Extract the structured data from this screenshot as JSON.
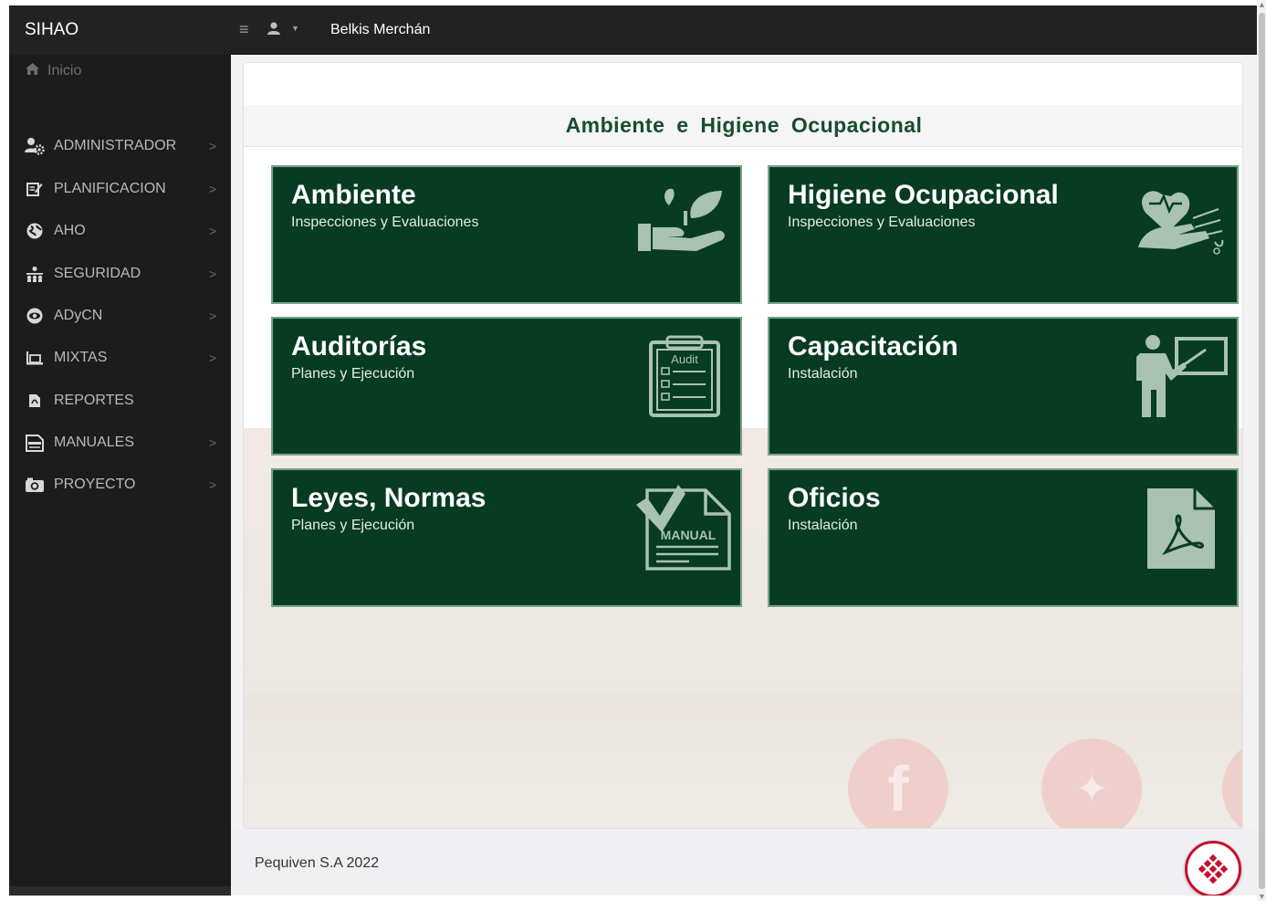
{
  "app": {
    "brand": "SIHAO"
  },
  "sidebar": {
    "home": {
      "label": "Inicio",
      "icon": "home-icon"
    },
    "items": [
      {
        "label": "ADMINISTRADOR",
        "icon": "users-gear-icon"
      },
      {
        "label": "PLANIFICACION",
        "icon": "edit-document-icon"
      },
      {
        "label": "AHO",
        "icon": "globe-icon"
      },
      {
        "label": "SEGURIDAD",
        "icon": "network-icon"
      },
      {
        "label": "ADyCN",
        "icon": "eye-icon"
      },
      {
        "label": "MIXTAS",
        "icon": "laptop-icon"
      },
      {
        "label": "REPORTES",
        "icon": "pdf-file-icon"
      },
      {
        "label": "MANUALES",
        "icon": "manual-icon"
      },
      {
        "label": "PROYECTO",
        "icon": "camera-icon"
      }
    ]
  },
  "topbar": {
    "username": "Belkis Merchán"
  },
  "main": {
    "heading": "Ambiente e Higiene Ocupacional",
    "tiles": [
      {
        "title": "Ambiente",
        "subtitle": "Inspecciones y Evaluaciones",
        "icon": "plant-hand-icon"
      },
      {
        "title": "Higiene Ocupacional",
        "subtitle": "Inspecciones y Evaluaciones",
        "icon": "heart-hand-icon"
      },
      {
        "title": "Auditorías",
        "subtitle": "Planes y Ejecución",
        "icon": "audit-clipboard-icon",
        "icon_text": "Audit"
      },
      {
        "title": "Capacitación",
        "subtitle": "Instalación",
        "icon": "teacher-board-icon"
      },
      {
        "title": "Leyes, Normas",
        "subtitle": "Planes y Ejecución",
        "icon": "manual-document-icon",
        "icon_text": "MANUAL"
      },
      {
        "title": "Oficios",
        "subtitle": "Instalación",
        "icon": "pdf-document-icon"
      }
    ]
  },
  "footer": {
    "text": "Pequiven S.A 2022"
  },
  "colors": {
    "tile_bg": "#073b22",
    "heading": "#174d2d",
    "sidebar_bg": "#1c1c1c",
    "topbar_bg": "#222222",
    "brand_red": "#c8102e"
  }
}
